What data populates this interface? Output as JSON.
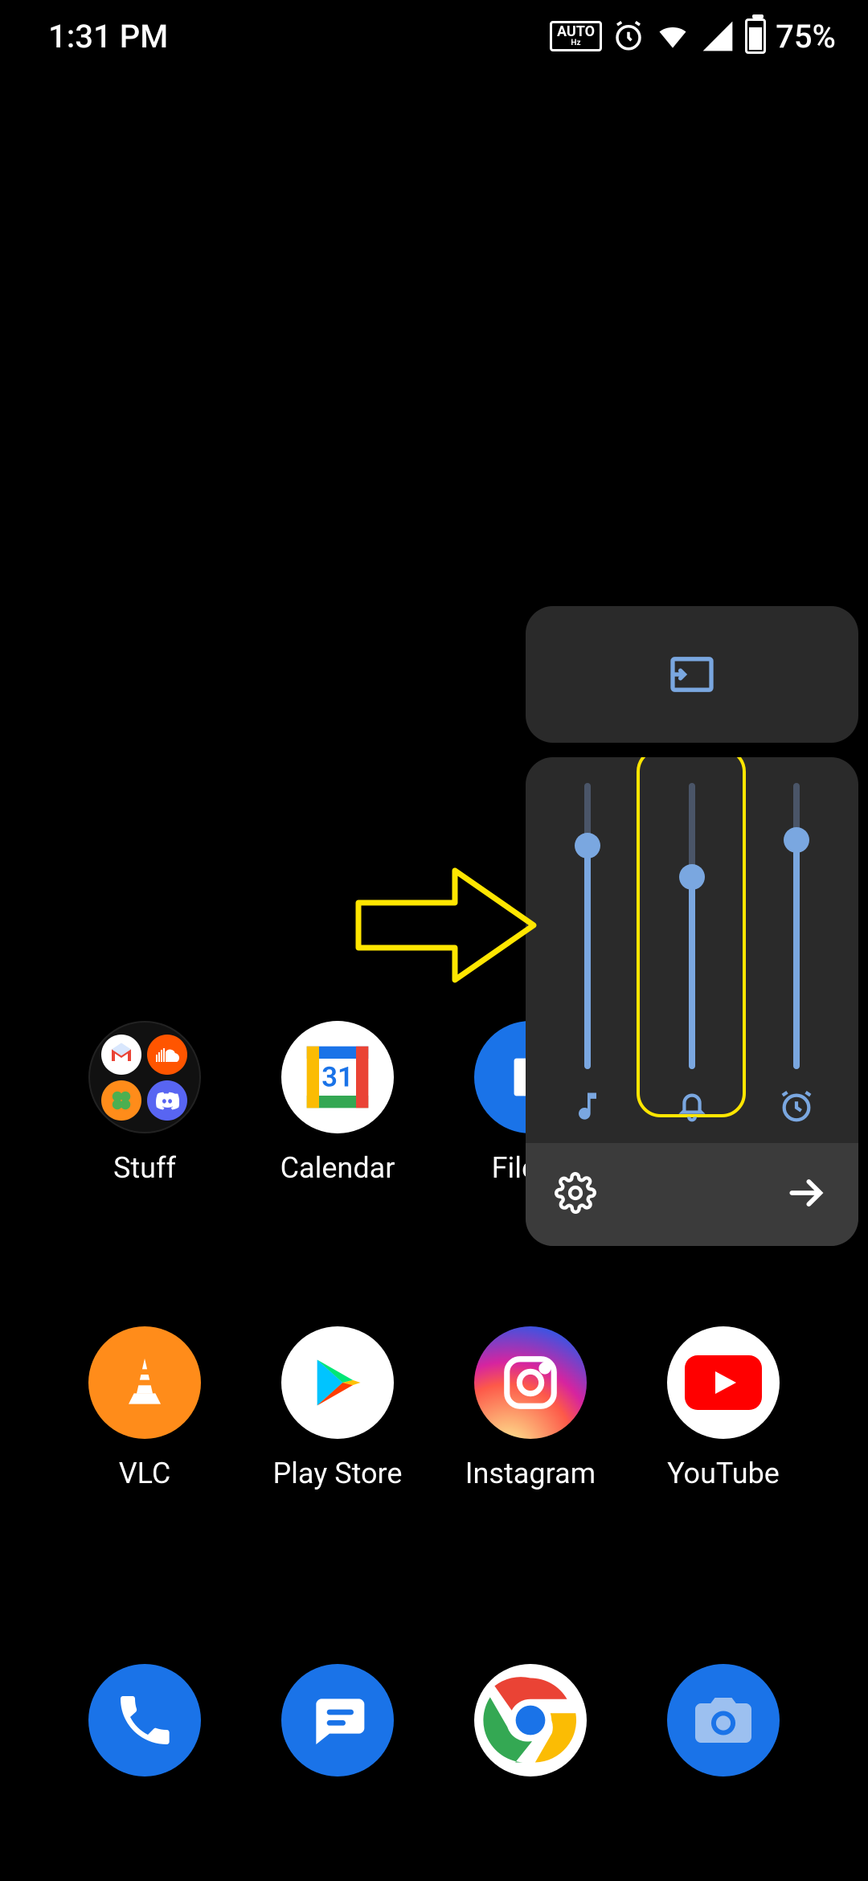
{
  "status": {
    "time": "1:31 PM",
    "auto_hz_top": "AUTO",
    "auto_hz_bottom": "Hz",
    "battery_pct": "75%"
  },
  "folder": {
    "name": "Stuff"
  },
  "apps": {
    "calendar": {
      "label": "Calendar",
      "day": "31"
    },
    "filemanager": {
      "label": "File M"
    },
    "vlc": {
      "label": "VLC"
    },
    "playstore": {
      "label": "Play Store"
    },
    "instagram": {
      "label": "Instagram"
    },
    "youtube": {
      "label": "YouTube"
    }
  },
  "volume": {
    "sliders": {
      "media": {
        "pct": 78,
        "icon": "music-note"
      },
      "ring": {
        "pct": 67,
        "icon": "bell"
      },
      "alarm": {
        "pct": 80,
        "icon": "alarm-clock"
      }
    },
    "highlighted": "ring"
  },
  "colors": {
    "accent": "#7aa7e0",
    "panel": "#2a2a2a",
    "footer": "#3b3b3b",
    "highlight": "#ffe600"
  }
}
